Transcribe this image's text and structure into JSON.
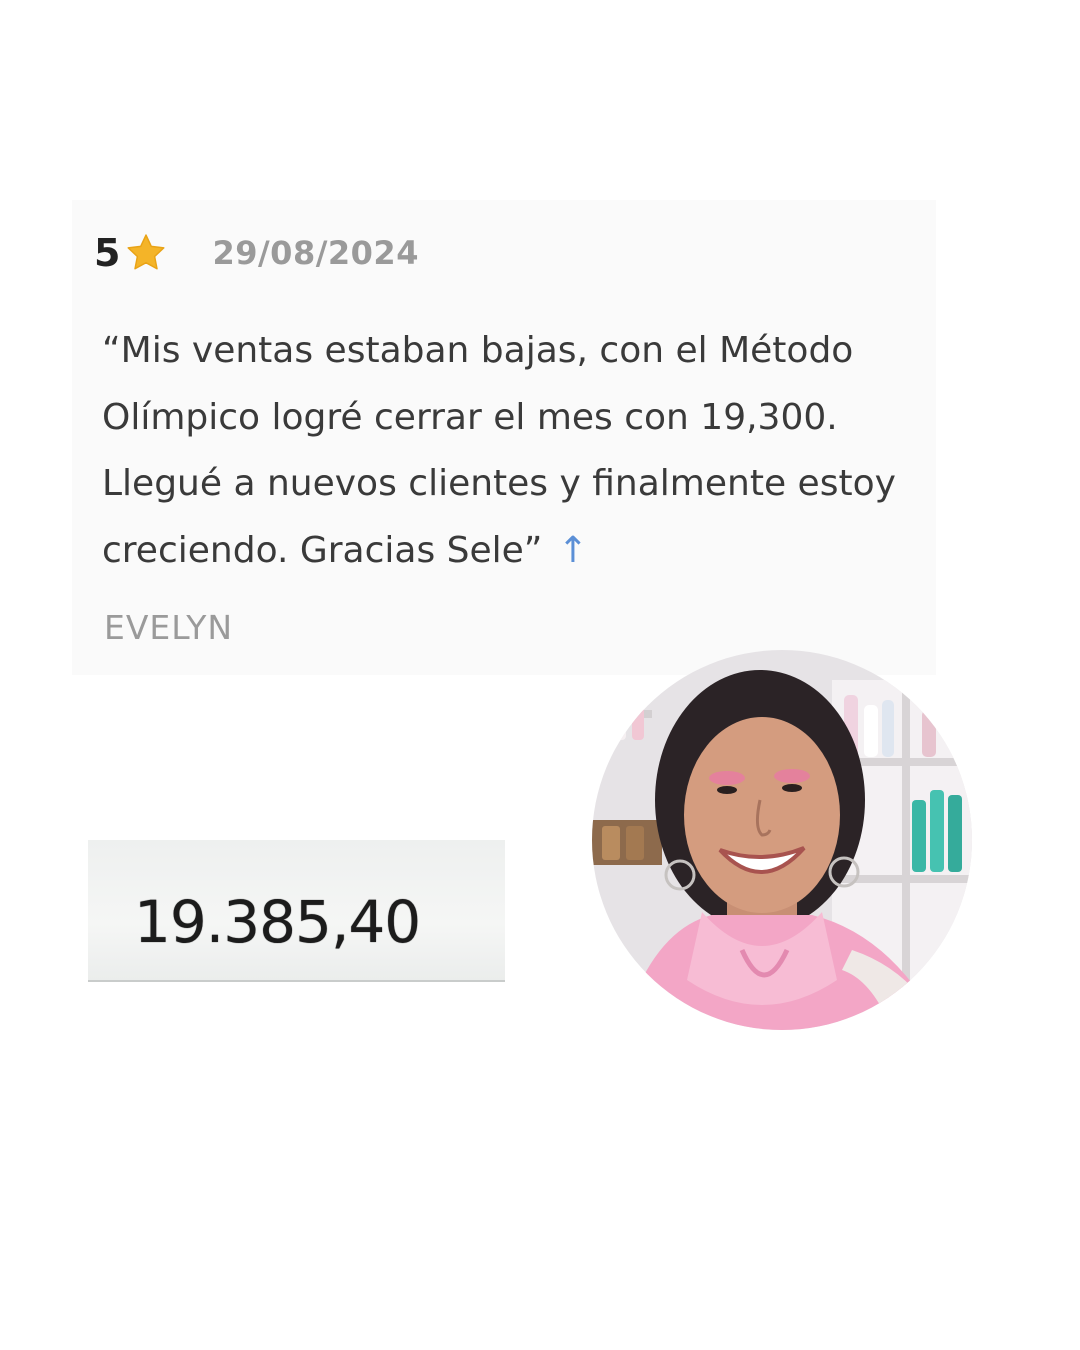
{
  "review": {
    "rating": "5",
    "date": "29/08/2024",
    "text": "“Mis ventas estaban bajas, con el Método Olímpico logré cerrar el mes con 19,300. Llegué a nuevos clientes y finalmente estoy creciendo. Gracias Sele”",
    "arrow": "↑",
    "reviewer": "EVELYN",
    "star_color": "#f4b428",
    "icons": [
      "star-icon",
      "up-arrow-icon"
    ]
  },
  "amount": {
    "value": "19.385,40"
  },
  "avatar": {
    "accent": "#f3a6c6",
    "subject": "smiling woman with pink scarf in front of shelves"
  }
}
